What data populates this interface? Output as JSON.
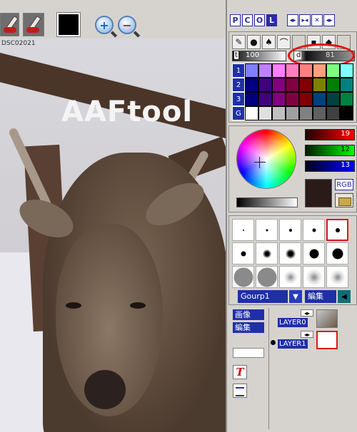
{
  "canvas": {
    "watermark": "AAFtool",
    "corner_label": "DSC02021"
  },
  "palette_tabs": [
    "P",
    "C",
    "O",
    "L"
  ],
  "window_controls": [
    "◂▸",
    "▸◂",
    "✕",
    "◂▸"
  ],
  "tools": {
    "opacity_label": "t",
    "opacity_value": "100",
    "density_label": "d",
    "density_value": "81"
  },
  "palette": {
    "rows": [
      {
        "label": "1",
        "colors": [
          "#7f7fff",
          "#bf7fff",
          "#ff7fff",
          "#ff7fbf",
          "#ff7f7f",
          "#ff9f7f",
          "#7fff7f",
          "#7fffff"
        ]
      },
      {
        "label": "2",
        "colors": [
          "#000080",
          "#400080",
          "#800080",
          "#800040",
          "#800000",
          "#808000",
          "#008000",
          "#008080"
        ]
      },
      {
        "label": "3",
        "colors": [
          "#00007f",
          "#3f007f",
          "#7f007f",
          "#7f003f",
          "#7f0000",
          "#003f7f",
          "#004040",
          "#008040"
        ]
      },
      {
        "label": "G",
        "colors": [
          "#ffffff",
          "#e0e0e0",
          "#c0c0c0",
          "#a0a0a0",
          "#808080",
          "#606060",
          "#404040",
          "#000000"
        ]
      }
    ]
  },
  "color": {
    "r": "19",
    "g": "12",
    "b": "13",
    "mode_label": "RGB",
    "current": "#2a1a18"
  },
  "brushes": {
    "group_label": "Gourp1",
    "edit_label": "編集"
  },
  "layers": {
    "image_label": "画像",
    "edit_label": "編集",
    "items": [
      {
        "name": "LAYER0",
        "arrows": "◂▸"
      },
      {
        "name": "LAYER1",
        "arrows": "◂▸"
      }
    ]
  }
}
